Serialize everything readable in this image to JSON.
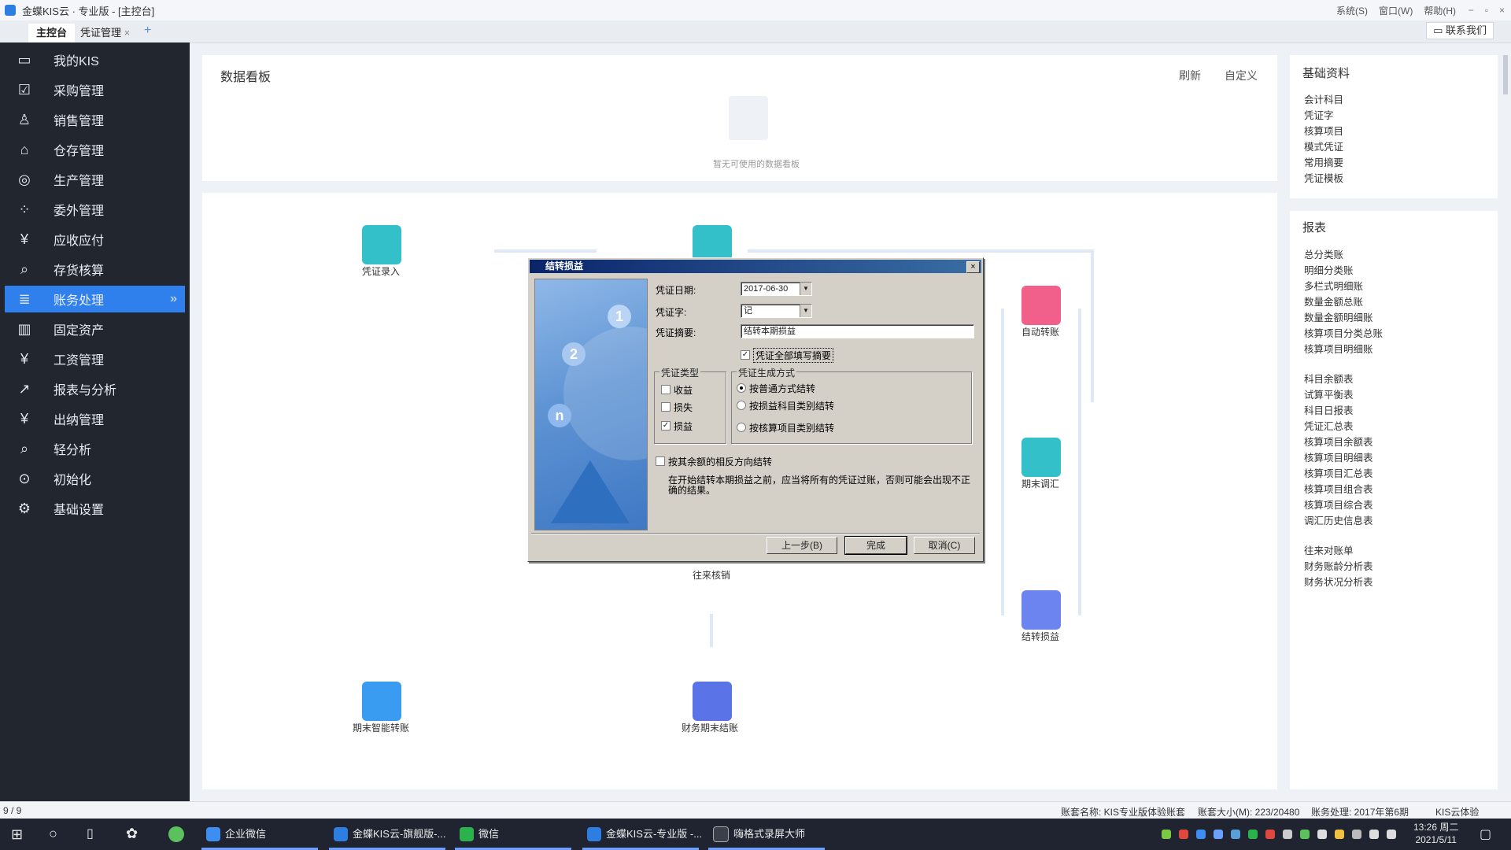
{
  "window": {
    "title": "金蝶KIS云 · 专业版 - [主控台]",
    "menus": [
      "系统(S)",
      "窗口(W)",
      "帮助(H)"
    ],
    "controls": [
      "−",
      "▫",
      "×"
    ]
  },
  "tabs": [
    {
      "label": "主控台"
    },
    {
      "label": "凭证管理",
      "close": "×"
    }
  ],
  "tab_add": "+",
  "contact_button": "联系我们",
  "sidebar": {
    "items": [
      {
        "label": "我的KIS",
        "icon": "monitor-icon"
      },
      {
        "label": "采购管理",
        "icon": "purchase-icon"
      },
      {
        "label": "销售管理",
        "icon": "sales-icon"
      },
      {
        "label": "仓存管理",
        "icon": "warehouse-icon"
      },
      {
        "label": "生产管理",
        "icon": "production-icon"
      },
      {
        "label": "委外管理",
        "icon": "outsource-icon"
      },
      {
        "label": "应收应付",
        "icon": "receivable-icon"
      },
      {
        "label": "存货核算",
        "icon": "inventory-icon"
      },
      {
        "label": "账务处理",
        "icon": "accounting-icon",
        "active": true
      },
      {
        "label": "固定资产",
        "icon": "asset-icon"
      },
      {
        "label": "工资管理",
        "icon": "salary-icon"
      },
      {
        "label": "报表与分析",
        "icon": "report-icon"
      },
      {
        "label": "出纳管理",
        "icon": "cashier-icon"
      },
      {
        "label": "轻分析",
        "icon": "analysis-icon"
      },
      {
        "label": "初始化",
        "icon": "init-icon"
      },
      {
        "label": "基础设置",
        "icon": "settings-icon"
      }
    ],
    "active_more": "»"
  },
  "dashboard": {
    "title": "数据看板",
    "refresh": "刷新",
    "customize": "自定义",
    "empty_text": "暂无可使用的数据看板"
  },
  "flow": {
    "voucher_entry": "凭证录入",
    "auto_transfer": "自动转账",
    "period_adjust": "期末调汇",
    "profit_transfer": "结转损益",
    "ar_ap_writeoff": "往来核销",
    "smart_transfer": "期末智能转账",
    "period_close": "财务期末结账"
  },
  "basic_data": {
    "title": "基础资料",
    "items": [
      "会计科目",
      "凭证字",
      "核算项目",
      "模式凭证",
      "常用摘要",
      "凭证模板"
    ]
  },
  "reports": {
    "title": "报表",
    "group1": [
      "总分类账",
      "明细分类账",
      "多栏式明细账",
      "数量金额总账",
      "数量金额明细账",
      "核算项目分类总账",
      "核算项目明细账"
    ],
    "group2": [
      "科目余额表",
      "试算平衡表",
      "科目日报表",
      "凭证汇总表",
      "核算项目余额表",
      "核算项目明细表",
      "核算项目汇总表",
      "核算项目组合表",
      "核算项目综合表",
      "调汇历史信息表"
    ],
    "group3": [
      "往来对账单",
      "财务账龄分析表",
      "财务状况分析表"
    ]
  },
  "dialog": {
    "title": "结转损益",
    "close": "×",
    "voucher_date_label": "凭证日期:",
    "voucher_date": "2017-06-30",
    "voucher_word_label": "凭证字:",
    "voucher_word": "记",
    "summary_label": "凭证摘要:",
    "summary": "结转本期损益",
    "fill_all_summary": "凭证全部填写摘要",
    "type_group": "凭证类型",
    "types": [
      {
        "label": "收益",
        "checked": false
      },
      {
        "label": "损失",
        "checked": false
      },
      {
        "label": "损益",
        "checked": true
      }
    ],
    "method_group": "凭证生成方式",
    "methods": [
      {
        "label": "按普通方式结转",
        "selected": true
      },
      {
        "label": "按损益科目类别结转",
        "selected": false
      },
      {
        "label": "按核算项目类别结转",
        "selected": false
      }
    ],
    "reverse_label": "按其余额的相反方向结转",
    "note": "在开始结转本期损益之前，应当将所有的凭证过账，否则可能会出现不正确的结果。",
    "prev_button": "上一步(B)",
    "finish_button": "完成",
    "cancel_button": "取消(C)",
    "image_digits": [
      "1",
      "2",
      "n"
    ]
  },
  "status_bar": {
    "page": "9 / 9",
    "account_name": "账套名称: KIS专业版体验账套",
    "account_size": "账套大小(M): 223/20480",
    "period": "账务处理: 2017年第6期",
    "user": "KIS云体验"
  },
  "taskbar": {
    "items": [
      "企业微信",
      "金蝶KIS云-旗舰版-...",
      "微信",
      "金蝶KIS云-专业版 -...",
      "嗨格式录屏大师"
    ],
    "time": "13:26 周二",
    "date": "2021/5/11"
  },
  "colors": {
    "sidebar_bg": "#22262e",
    "accent": "#2f80ed",
    "dialog_bg": "#d4d0c8",
    "title_blue": "#0a246a"
  }
}
